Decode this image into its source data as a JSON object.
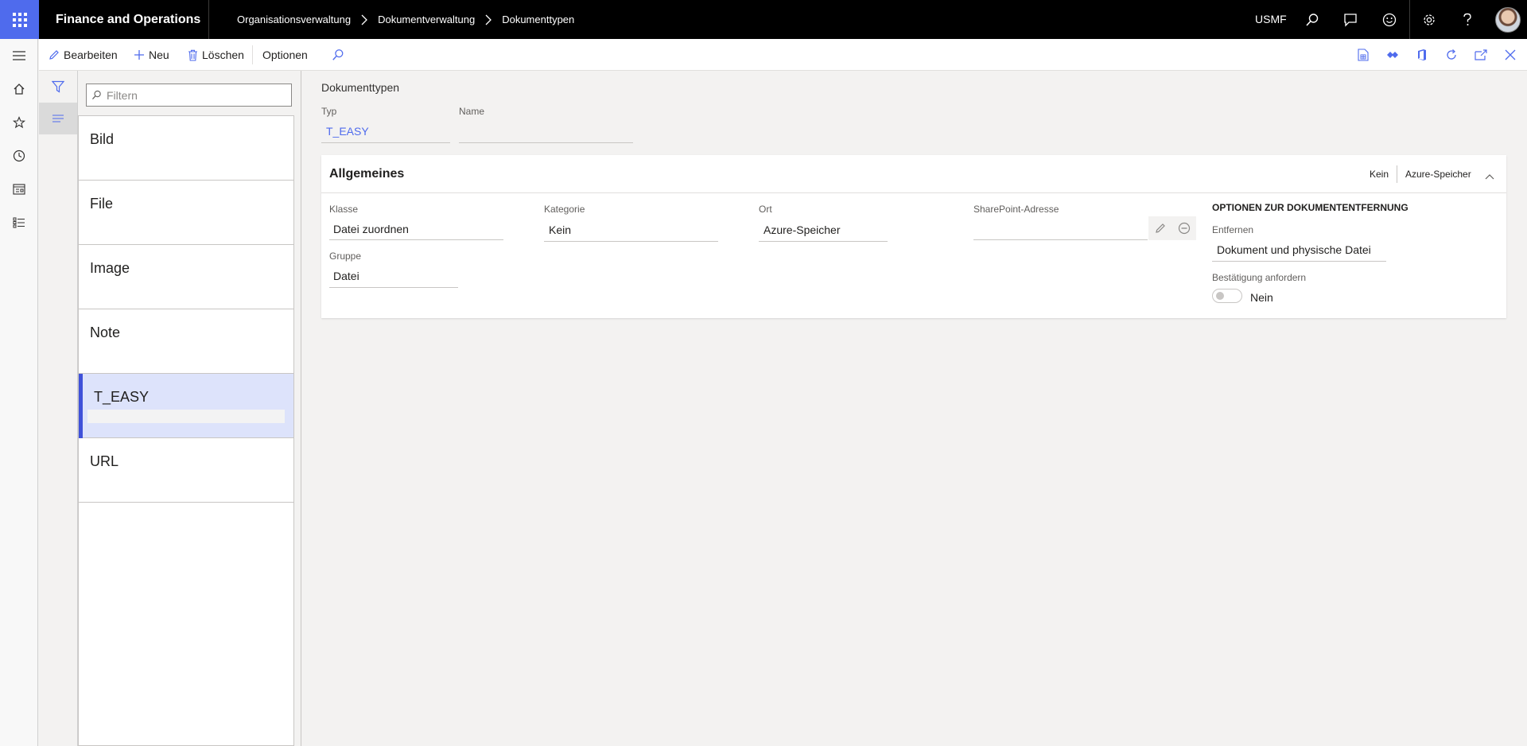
{
  "topbar": {
    "app_title": "Finance and Operations",
    "breadcrumb": [
      "Organisationsverwaltung",
      "Dokumentverwaltung",
      "Dokumenttypen"
    ],
    "company": "USMF"
  },
  "actions": {
    "edit": "Bearbeiten",
    "new": "Neu",
    "delete": "Löschen",
    "options": "Optionen"
  },
  "list": {
    "filter_placeholder": "Filtern",
    "items": [
      "Bild",
      "File",
      "Image",
      "Note",
      "T_EASY",
      "URL"
    ],
    "selected": "T_EASY"
  },
  "form": {
    "caption": "Dokumenttypen",
    "type_label": "Typ",
    "type_value": "T_EASY",
    "name_label": "Name",
    "name_value": ""
  },
  "general": {
    "title": "Allgemeines",
    "summary": [
      "Kein",
      "Azure-Speicher"
    ],
    "class_label": "Klasse",
    "class_value": "Datei zuordnen",
    "group_label": "Gruppe",
    "group_value": "Datei",
    "category_label": "Kategorie",
    "category_value": "Kein",
    "location_label": "Ort",
    "location_value": "Azure-Speicher",
    "sharepoint_label": "SharePoint-Adresse",
    "sharepoint_value": "",
    "removal_caption": "OPTIONEN ZUR DOKUMENTENTFERNUNG",
    "remove_label": "Entfernen",
    "remove_value": "Dokument und physische Datei",
    "confirm_label": "Bestätigung anfordern",
    "confirm_value": "Nein"
  },
  "colors": {
    "accent": "#4f6bed",
    "topbar": "#000000",
    "selected_row": "#dde3fb"
  }
}
